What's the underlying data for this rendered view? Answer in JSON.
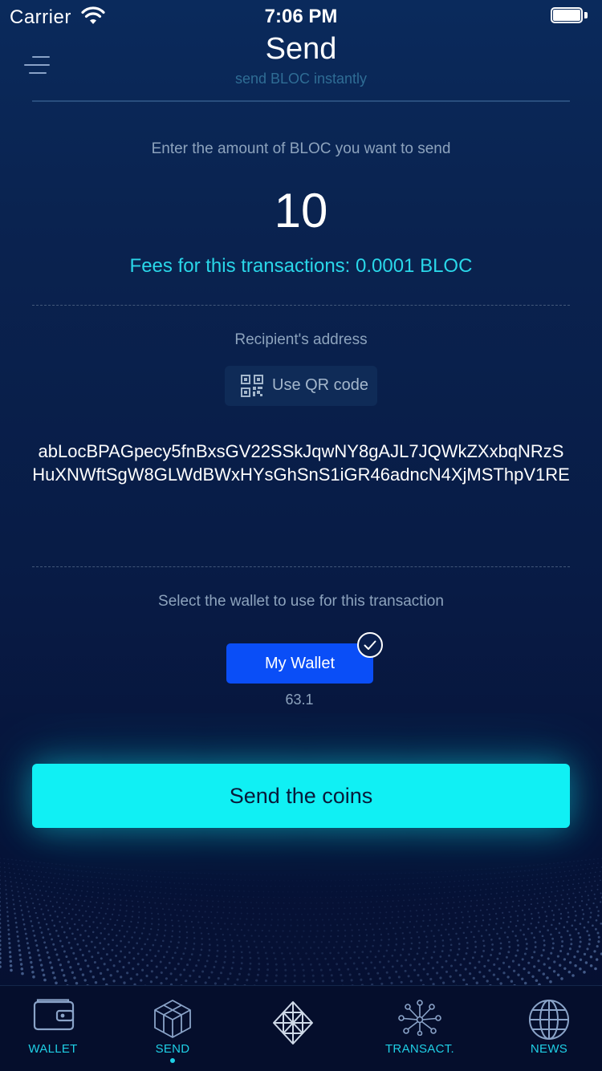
{
  "status_bar": {
    "carrier": "Carrier",
    "time": "7:06 PM"
  },
  "header": {
    "title": "Send",
    "subtitle": "send BLOC instantly",
    "menu_icon": "hamburger-menu-icon"
  },
  "amount_section": {
    "label": "Enter the amount of BLOC you want to send",
    "amount_value": "10",
    "fees_text": "Fees for this transactions: 0.0001 BLOC"
  },
  "recipient_section": {
    "label": "Recipient's address",
    "qr_button_label": "Use QR code",
    "address_line1": "abLocBPAGpecy5fnBxsGV22SSkJqwNY8gAJL7JQWkZXxbqNRzS",
    "address_line2": "HuXNWftSgW8GLWdBWxHYsGhSnS1iGR46adncN4XjMSThpV1RE"
  },
  "wallet_section": {
    "label": "Select the wallet to use for this transaction",
    "wallet_name": "My Wallet",
    "wallet_balance": "63.1",
    "selected": true
  },
  "send_button_label": "Send the coins",
  "tab_bar": {
    "tabs": [
      {
        "label": "WALLET",
        "icon": "wallet-icon",
        "active": false
      },
      {
        "label": "SEND",
        "icon": "send-cube-icon",
        "active": true
      },
      {
        "label": "",
        "icon": "bloc-logo-icon",
        "active": false
      },
      {
        "label": "TRANSACT.",
        "icon": "network-icon",
        "active": false
      },
      {
        "label": "NEWS",
        "icon": "globe-icon",
        "active": false
      }
    ]
  },
  "colors": {
    "accent_cyan": "#10f0f4",
    "fees_cyan": "#2ad7e9",
    "wallet_blue": "#0a4ef7",
    "background": "#081b45"
  }
}
